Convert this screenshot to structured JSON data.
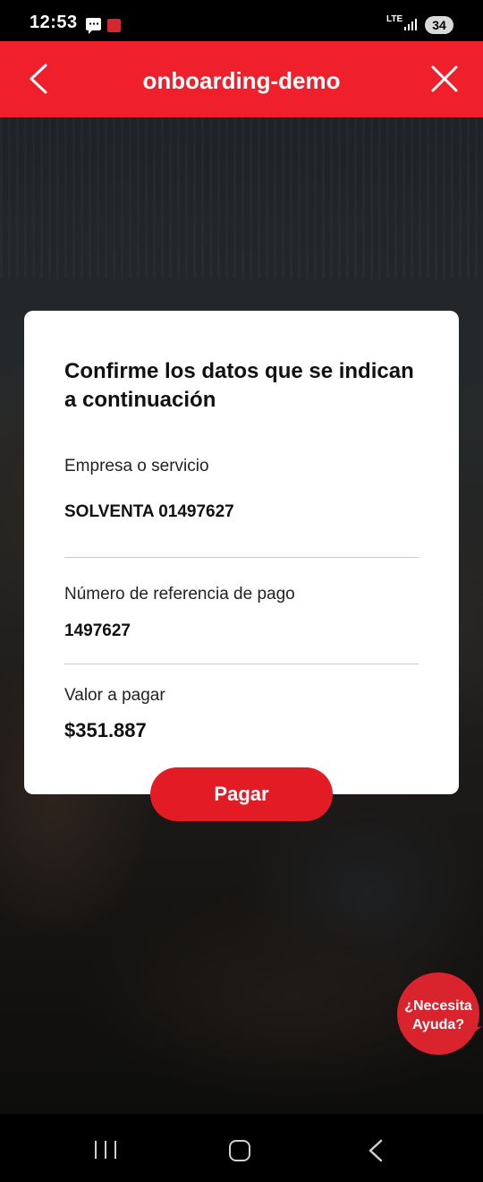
{
  "status_bar": {
    "time": "12:53",
    "network": "LTE",
    "battery": "34"
  },
  "header": {
    "title": "onboarding-demo",
    "color": "#ef1f2b"
  },
  "modal": {
    "title": "Confirme los datos que se indican a continuación",
    "fields": [
      {
        "label": "Empresa o servicio",
        "value": "SOLVENTA 01497627"
      },
      {
        "label": "Número de referencia de pago",
        "value": "1497627"
      },
      {
        "label": "Valor a pagar",
        "value": "$351.887"
      }
    ]
  },
  "pay_button": {
    "label": "Pagar",
    "color": "#e31b24"
  },
  "help": {
    "label": "¿Necesita Ayuda?",
    "color": "#d9232d"
  },
  "icons": {
    "header_back": "chevron-left-icon",
    "header_close": "close-icon",
    "status_message": "message-icon",
    "status_app": "app-notification-icon",
    "signal": "signal-icon",
    "nav_recents": "recents-icon",
    "nav_home": "home-icon",
    "nav_back": "back-icon"
  }
}
